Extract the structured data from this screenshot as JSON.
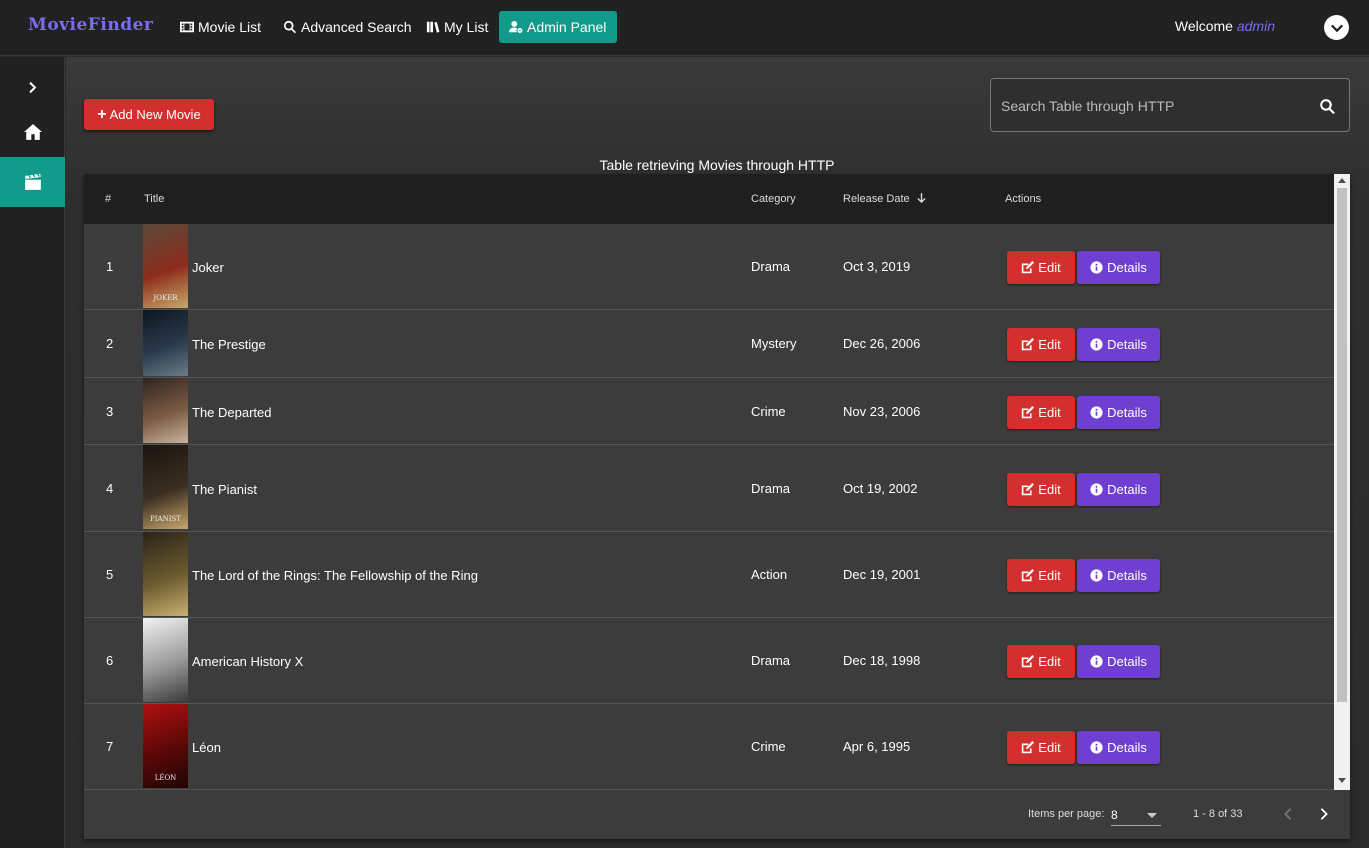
{
  "app": {
    "brand": "MovieFinder"
  },
  "nav": {
    "movie_list": "Movie List",
    "advanced_search": "Advanced Search",
    "my_list": "My List",
    "admin_panel": "Admin Panel"
  },
  "user": {
    "welcome": "Welcome",
    "name": "admin"
  },
  "toolbar": {
    "add_label": "Add New Movie",
    "search_placeholder": "Search Table through HTTP"
  },
  "table": {
    "caption": "Table retrieving Movies through HTTP",
    "headers": {
      "num": "#",
      "title": "Title",
      "category": "Category",
      "release_date": "Release Date",
      "actions": "Actions"
    },
    "sort": {
      "column": "Release Date",
      "direction": "descending"
    },
    "edit_label": "Edit",
    "details_label": "Details",
    "rows": [
      {
        "num": "1",
        "title": "Joker",
        "category": "Drama",
        "date": "Oct 3, 2019",
        "poster_colors": [
          "#5a4a3a",
          "#8c2c1c",
          "#c9a96a"
        ],
        "poster_text": "JOKER"
      },
      {
        "num": "2",
        "title": "The Prestige",
        "category": "Mystery",
        "date": "Dec 26, 2006",
        "poster_colors": [
          "#0d1620",
          "#2a3a4c",
          "#6b7c8a"
        ],
        "poster_text": ""
      },
      {
        "num": "3",
        "title": "The Departed",
        "category": "Crime",
        "date": "Nov 23, 2006",
        "poster_colors": [
          "#2e2420",
          "#7b5a44",
          "#c9b39a"
        ],
        "poster_text": ""
      },
      {
        "num": "4",
        "title": "The Pianist",
        "category": "Drama",
        "date": "Oct 19, 2002",
        "poster_colors": [
          "#1a1510",
          "#3a2e20",
          "#c9a76a"
        ],
        "poster_text": "PIANIST"
      },
      {
        "num": "5",
        "title": "The Lord of the Rings: The Fellowship of the Ring",
        "category": "Action",
        "date": "Dec 19, 2001",
        "poster_colors": [
          "#2a2418",
          "#6b5a30",
          "#c8b070"
        ],
        "poster_text": ""
      },
      {
        "num": "6",
        "title": "American History X",
        "category": "Drama",
        "date": "Dec 18, 1998",
        "poster_colors": [
          "#f2f2f2",
          "#9a9a9a",
          "#3a3a3a"
        ],
        "poster_text": ""
      },
      {
        "num": "7",
        "title": "Léon",
        "category": "Crime",
        "date": "Apr 6, 1995",
        "poster_colors": [
          "#b01010",
          "#5a0808",
          "#200404"
        ],
        "poster_text": "LÉON"
      }
    ]
  },
  "paginator": {
    "items_per_page_label": "Items per page:",
    "items_per_page": "8",
    "range": "1 - 8 of 33"
  },
  "colors": {
    "brand": "#7b6cf0",
    "teal_accent": "#129a8a",
    "edit_red": "#d32f2f",
    "details_purple": "#6f3fd1"
  },
  "icons": {
    "movie_list": "film-icon",
    "advanced_search": "search-icon",
    "my_list": "books-icon",
    "admin_panel": "user-cog-icon",
    "sidebar": [
      "chevron-right-icon",
      "home-icon",
      "clapperboard-icon"
    ]
  }
}
